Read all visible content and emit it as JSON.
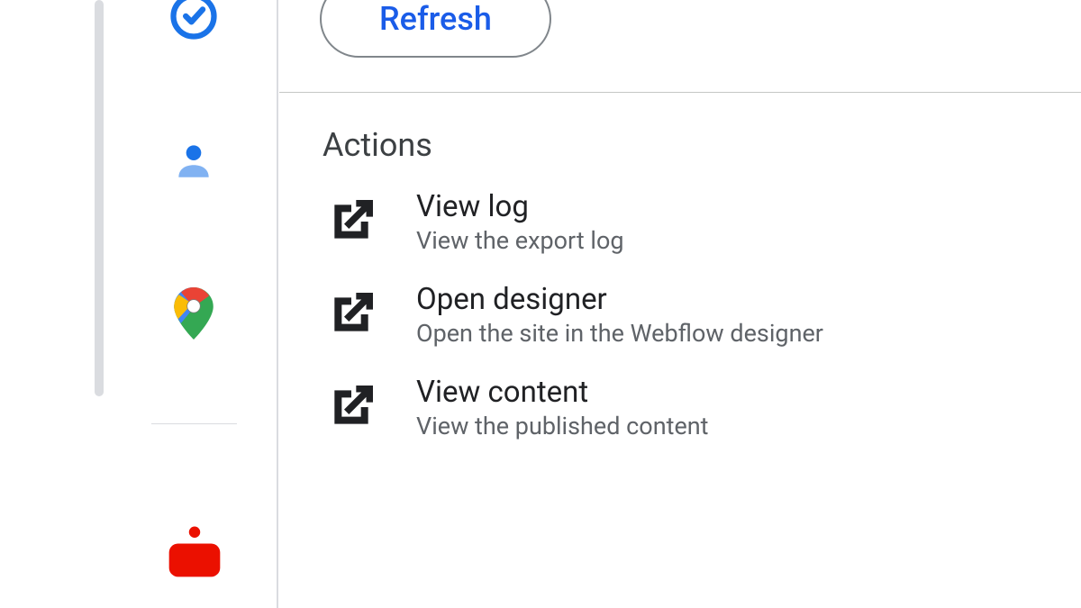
{
  "toolbar": {
    "refresh_label": "Refresh"
  },
  "section": {
    "title": "Actions",
    "items": [
      {
        "title": "View log",
        "desc": "View the export log"
      },
      {
        "title": "Open designer",
        "desc": "Open the site in the Webflow designer"
      },
      {
        "title": "View content",
        "desc": "View the published content"
      }
    ]
  }
}
